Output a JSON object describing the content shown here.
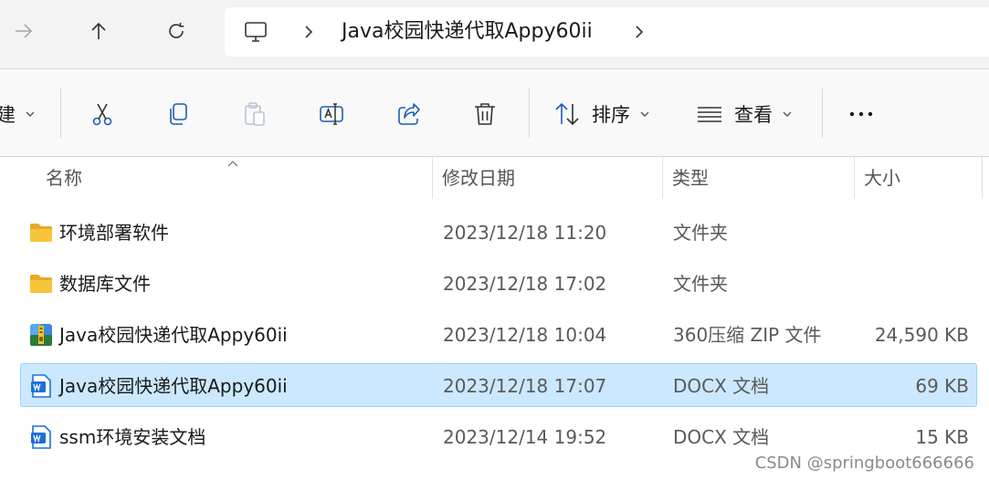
{
  "address": {
    "crumbs": [
      "Java校园快递代取Appy60ii"
    ]
  },
  "toolbar": {
    "new_partial_label": "建",
    "sort_label": "排序",
    "view_label": "查看"
  },
  "columns": {
    "name": "名称",
    "modified": "修改日期",
    "type": "类型",
    "size": "大小"
  },
  "files": [
    {
      "icon": "folder-icon",
      "name": "环境部署软件",
      "modified": "2023/12/18 11:20",
      "type": "文件夹",
      "size": "",
      "selected": false
    },
    {
      "icon": "folder-icon",
      "name": "数据库文件",
      "modified": "2023/12/18 17:02",
      "type": "文件夹",
      "size": "",
      "selected": false
    },
    {
      "icon": "zip-archive-icon",
      "name": "Java校园快递代取Appy60ii",
      "modified": "2023/12/18 10:04",
      "type": "360压缩 ZIP 文件",
      "size": "24,590 KB",
      "selected": false
    },
    {
      "icon": "word-document-icon",
      "name": "Java校园快递代取Appy60ii",
      "modified": "2023/12/18 17:07",
      "type": "DOCX 文档",
      "size": "69 KB",
      "selected": true
    },
    {
      "icon": "word-document-icon",
      "name": "ssm环境安装文档",
      "modified": "2023/12/14 19:52",
      "type": "DOCX 文档",
      "size": "15 KB",
      "selected": false
    }
  ],
  "watermark": "CSDN @springboot666666",
  "colors": {
    "selection_bg": "#cce8ff",
    "selection_border": "#99d1ff",
    "folder_yellow": "#f8c53a",
    "word_blue": "#1e6fd9"
  }
}
